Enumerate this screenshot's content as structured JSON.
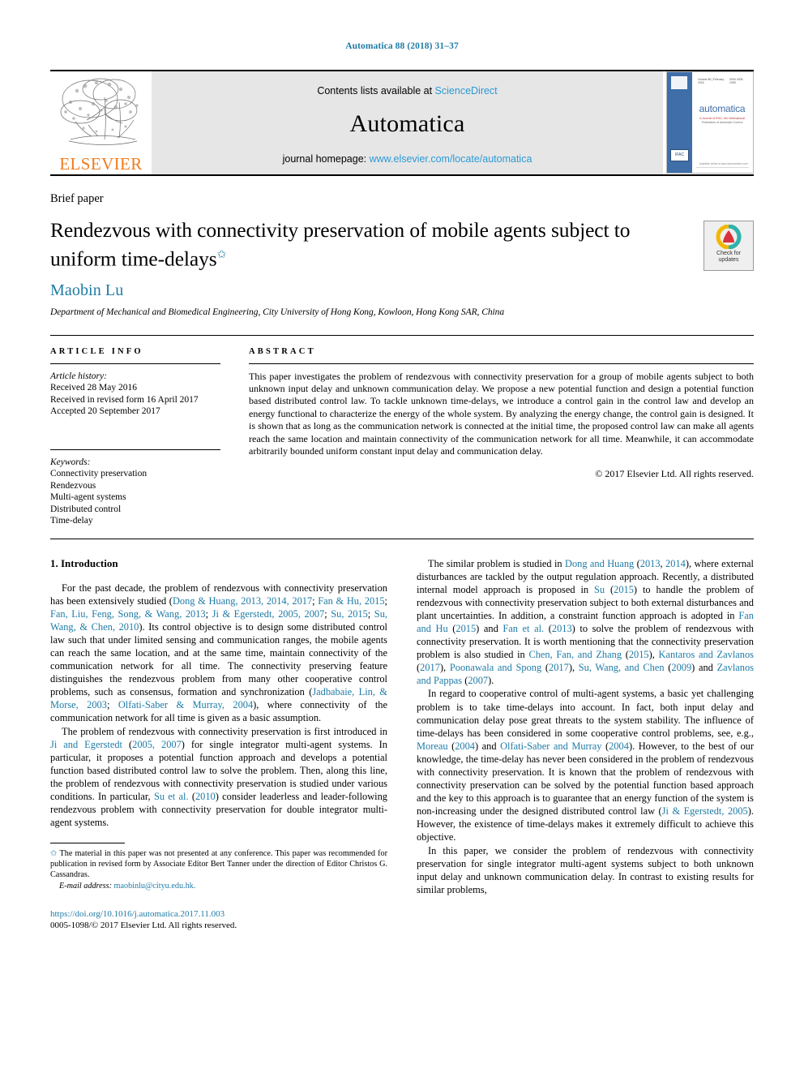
{
  "running_head": "Automatica 88 (2018) 31–37",
  "masthead": {
    "contents_prefix": "Contents lists available at ",
    "contents_link": "ScienceDirect",
    "journal_name": "Automatica",
    "homepage_prefix": "journal homepage: ",
    "homepage_link": "www.elsevier.com/locate/automatica",
    "publisher_word": "ELSEVIER",
    "publisher_logo_icon": "elsevier-tree-icon",
    "cover": {
      "vol_line": "Volume 88 | February 2018",
      "issn_line": "ISSN 0005-1098",
      "title": "automatica",
      "subtitle_line1": "A Journal of IFAC, the International",
      "subtitle_line2": "Federation of Automatic Control",
      "ifac_badge": "IFAC",
      "bottom_caption": "Available online at www.sciencedirect.com"
    }
  },
  "article": {
    "kicker": "Brief paper",
    "title": "Rendezvous with connectivity preservation of mobile agents subject to uniform time-delays",
    "title_footnote_marker": "✩",
    "author": "Maobin Lu",
    "affiliation": "Department of Mechanical and Biomedical Engineering, City University of Hong Kong, Kowloon, Hong Kong SAR, China",
    "crossmark": {
      "icon": "crossmark-badge-icon",
      "label_line1": "Check for",
      "label_line2": "updates"
    }
  },
  "info": {
    "heading": "ARTICLE INFO",
    "history_label": "Article history:",
    "history": [
      "Received 28 May 2016",
      "Received in revised form 16 April 2017",
      "Accepted 20 September 2017"
    ],
    "keywords_label": "Keywords:",
    "keywords": [
      "Connectivity preservation",
      "Rendezvous",
      "Multi-agent systems",
      "Distributed control",
      "Time-delay"
    ]
  },
  "abstract": {
    "heading": "ABSTRACT",
    "text": "This paper investigates the problem of rendezvous with connectivity preservation for a group of mobile agents subject to both unknown input delay and unknown communication delay. We propose a new potential function and design a potential function based distributed control law. To tackle unknown time-delays, we introduce a control gain in the control law and develop an energy functional to characterize the energy of the whole system. By analyzing the energy change, the control gain is designed. It is shown that as long as the communication network is connected at the initial time, the proposed control law can make all agents reach the same location and maintain connectivity of the communication network for all time. Meanwhile, it can accommodate arbitrarily bounded uniform constant input delay and communication delay.",
    "copyright": "© 2017 Elsevier Ltd. All rights reserved."
  },
  "body": {
    "section_title": "1. Introduction",
    "left_paragraphs": [
      "For the past decade, the problem of rendezvous with connectivity preservation has been extensively studied (<a class=\"ref\">Dong &amp; Huang, 2013, 2014, 2017</a>; <a class=\"ref\">Fan &amp; Hu, 2015</a>; <a class=\"ref\">Fan, Liu, Feng, Song, &amp; Wang, 2013</a>; <a class=\"ref\">Ji &amp; Egerstedt, 2005, 2007</a>; <a class=\"ref\">Su, 2015</a>; <a class=\"ref\">Su, Wang, &amp; Chen, 2010</a>). Its control objective is to design some distributed control law such that under limited sensing and communication ranges, the mobile agents can reach the same location, and at the same time, maintain connectivity of the communication network for all time. The connectivity preserving feature distinguishes the rendezvous problem from many other cooperative control problems, such as consensus, formation and synchronization (<a class=\"ref\">Jadbabaie, Lin, &amp; Morse, 2003</a>; <a class=\"ref\">Olfati-Saber &amp; Murray, 2004</a>), where connectivity of the communication network for all time is given as a basic assumption.",
      "The problem of rendezvous with connectivity preservation is first introduced in <a class=\"ref\">Ji and Egerstedt</a> (<a class=\"ref\">2005, 2007</a>) for single integrator multi-agent systems. In particular, it proposes a potential function approach and develops a potential function based distributed control law to solve the problem. Then, along this line, the problem of rendezvous with connectivity preservation is studied under various conditions. In particular, <a class=\"ref\">Su et al.</a> (<a class=\"ref\">2010</a>) consider leaderless and leader-following rendezvous problem with connectivity preservation for double integrator multi-agent systems."
    ],
    "right_paragraphs": [
      "The similar problem is studied in <a class=\"ref\">Dong and Huang</a> (<a class=\"ref\">2013</a>, <a class=\"ref\">2014</a>), where external disturbances are tackled by the output regulation approach. Recently, a distributed internal model approach is proposed in <a class=\"ref\">Su</a> (<a class=\"ref\">2015</a>) to handle the problem of rendezvous with connectivity preservation subject to both external disturbances and plant uncertainties. In addition, a constraint function approach is adopted in <a class=\"ref\">Fan and Hu</a> (<a class=\"ref\">2015</a>) and <a class=\"ref\">Fan et al.</a> (<a class=\"ref\">2013</a>) to solve the problem of rendezvous with connectivity preservation. It is worth mentioning that the connectivity preservation problem is also studied in <a class=\"ref\">Chen, Fan, and Zhang</a> (<a class=\"ref\">2015</a>), <a class=\"ref\">Kantaros and Zavlanos</a> (<a class=\"ref\">2017</a>), <a class=\"ref\">Poonawala and Spong</a> (<a class=\"ref\">2017</a>), <a class=\"ref\">Su, Wang, and Chen</a> (<a class=\"ref\">2009</a>) and <a class=\"ref\">Zavlanos and Pappas</a> (<a class=\"ref\">2007</a>).",
      "In regard to cooperative control of multi-agent systems, a basic yet challenging problem is to take time-delays into account. In fact, both input delay and communication delay pose great threats to the system stability. The influence of time-delays has been considered in some cooperative control problems, see, e.g., <a class=\"ref\">Moreau</a> (<a class=\"ref\">2004</a>) and <a class=\"ref\">Olfati-Saber and Murray</a> (<a class=\"ref\">2004</a>). However, to the best of our knowledge, the time-delay has never been considered in the problem of rendezvous with connectivity preservation. It is known that the problem of rendezvous with connectivity preservation can be solved by the potential function based approach and the key to this approach is to guarantee that an energy function of the system is non-increasing under the designed distributed control law (<a class=\"ref\">Ji &amp; Egerstedt, 2005</a>). However, the existence of time-delays makes it extremely difficult to achieve this objective.",
      "In this paper, we consider the problem of rendezvous with connectivity preservation for single integrator multi-agent systems subject to both unknown input delay and unknown communication delay. In contrast to existing results for similar problems,"
    ]
  },
  "footnote": {
    "marker": "✩",
    "text": "The material in this paper was not presented at any conference. This paper was recommended for publication in revised form by Associate Editor Bert Tanner under the direction of Editor Christos G. Cassandras.",
    "email_label": "E-mail address:",
    "email": "maobinlu@cityu.edu.hk."
  },
  "footer": {
    "doi": "https://doi.org/10.1016/j.automatica.2017.11.003",
    "issn_line": "0005-1098/© 2017 Elsevier Ltd. All rights reserved."
  },
  "colors": {
    "link": "#1f7ba6",
    "sd_link": "#2a9ad6",
    "elsevier_orange": "#f07c1c",
    "cover_blue": "#3f6ea8",
    "band_gray": "#e6e6e6"
  }
}
